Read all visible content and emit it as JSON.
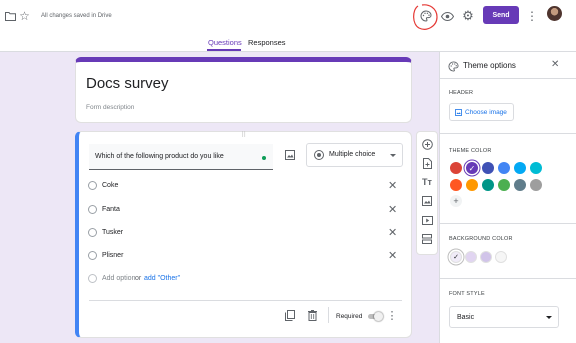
{
  "topbar": {
    "status_text": "All changes saved in Drive",
    "send_label": "Send"
  },
  "tabs": [
    {
      "label": "Questions",
      "active": true
    },
    {
      "label": "Responses",
      "active": false
    }
  ],
  "form": {
    "title": "Docs survey",
    "description_placeholder": "Form description"
  },
  "question": {
    "text": "Which of the following product do you like",
    "type_label": "Multiple choice",
    "options": [
      "Coke",
      "Fanta",
      "Tusker",
      "Plisner"
    ],
    "add_option_label": "Add option",
    "or_label": "or",
    "add_other_label": "add \"Other\"",
    "required_label": "Required"
  },
  "theme_panel": {
    "title": "Theme options",
    "header_section": "HEADER",
    "choose_image_label": "Choose image",
    "theme_color_section": "THEME COLOR",
    "theme_colors": [
      "#db4437",
      "#673ab7",
      "#3f51b5",
      "#4285f4",
      "#03a9f4",
      "#00bcd4",
      "#ff5722",
      "#ff9800",
      "#009688",
      "#4caf50",
      "#607d8b",
      "#9e9e9e"
    ],
    "selected_theme_color": "#673ab7",
    "background_color_section": "BACKGROUND COLOR",
    "background_colors": [
      "#f0ebf8",
      "#e1d5f1",
      "#d1c4e9",
      "#f6f6f6"
    ],
    "font_style_section": "FONT STYLE",
    "font_style_value": "Basic"
  },
  "colors": {
    "accent": "#673ab7",
    "annotation": "#e53935",
    "link": "#1a73e8"
  }
}
